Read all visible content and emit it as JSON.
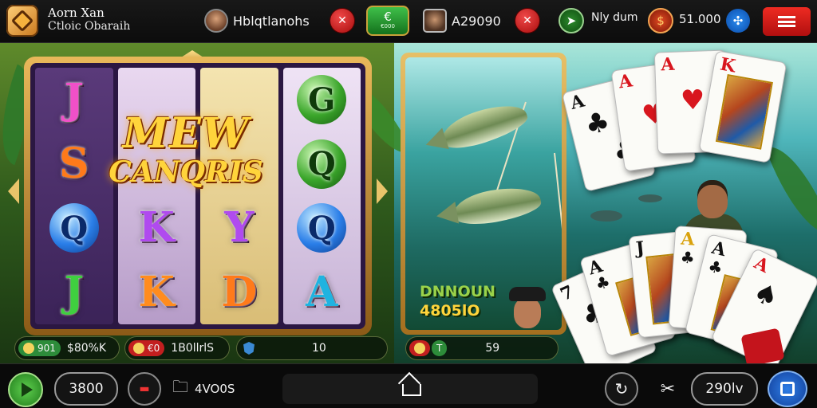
{
  "header": {
    "brand_line1": "Aorn Xan",
    "brand_line2": "Ctloic Obaraih",
    "player1_name": "Hblqtlanohs",
    "player2_balance": "A29090",
    "green_button_top": "€",
    "green_button_bottom": "€000",
    "arrow_label": "Nly dum",
    "coin_amount": "51.000"
  },
  "slot": {
    "title_line1": "MEW",
    "title_line2": "CANQRIS",
    "reels": [
      [
        "J",
        "S",
        "Q",
        "J"
      ],
      [
        "",
        "",
        "K",
        "K"
      ],
      [
        "",
        "",
        "Y",
        "D"
      ],
      [
        "G",
        "Q",
        "Q",
        "A"
      ]
    ]
  },
  "fish_card": {
    "line1": "DNNOUN",
    "line2": "4805lO"
  },
  "cards_hand_top": [
    {
      "rank": "A",
      "suit": "♣"
    },
    {
      "rank": "A",
      "suit": "♥"
    },
    {
      "rank": "A",
      "suit": "♥"
    },
    {
      "rank": "K",
      "suit": "♥"
    }
  ],
  "cards_hand_bottom": [
    {
      "rank": "7",
      "suit": "♣"
    },
    {
      "rank": "A",
      "suit": "♣"
    },
    {
      "rank": "J",
      "suit": "♣"
    },
    {
      "rank": "A",
      "suit": "♣"
    },
    {
      "rank": "A",
      "suit": "♣"
    },
    {
      "rank": "A",
      "suit": "♠"
    }
  ],
  "info_strip": {
    "badge1": "901",
    "value1": "$80%K",
    "badge2": "€0",
    "value2": "1B0llrlS",
    "value3": "10",
    "badge4": "T",
    "value4": "59"
  },
  "navbar": {
    "bet_value": "3800",
    "mode_label": "4VO0S",
    "total_value": "290lv"
  },
  "colors": {
    "accent_green": "#3fbf4a",
    "accent_red": "#d8161e",
    "accent_gold": "#e9b85a",
    "accent_blue": "#2a8cf0"
  }
}
